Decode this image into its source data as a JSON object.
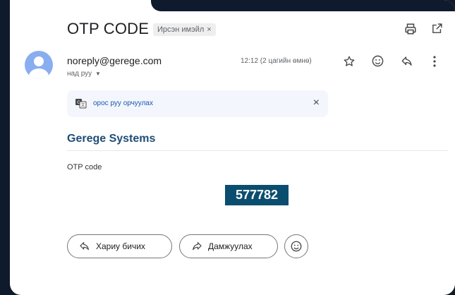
{
  "email": {
    "subject": "OTP CODE",
    "label_chip": "Ирсэн имэйл",
    "label_chip_close": "×",
    "sender": "noreply@gerege.com",
    "recipient": "над руу",
    "timestamp": "12:12 (2 цагийн өмнө)"
  },
  "translate": {
    "link": "орос руу орчуулах",
    "close": "×"
  },
  "body": {
    "brand": "Gerege Systems",
    "otp_label": "OTP code",
    "otp_code": "577782"
  },
  "actions": {
    "reply": "Хариу бичих",
    "forward": "Дамжуулах"
  },
  "colors": {
    "brand_text": "#1e4d78",
    "otp_box": "#0b4d6e",
    "link": "#1a56b0",
    "avatar": "#89aef0"
  }
}
